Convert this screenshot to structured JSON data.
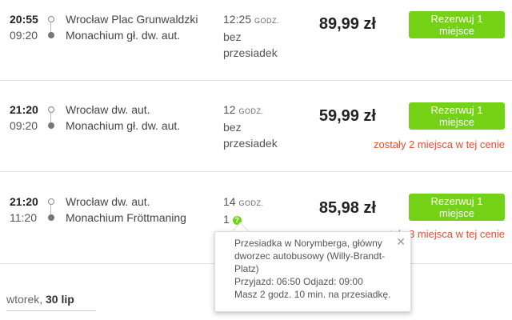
{
  "connections": [
    {
      "departure": "20:55",
      "arrival": "09:20",
      "from": "Wrocław Plac Grunwaldzki",
      "to": "Monachium gł. dw. aut.",
      "duration_num": "12:25",
      "duration_unit": "GODZ.",
      "transfer_line1": "bez",
      "transfer_line2": "przesiadek",
      "price": "89,99 zł",
      "button": "Rezerwuj 1 miejsce",
      "note": ""
    },
    {
      "departure": "21:20",
      "arrival": "09:20",
      "from": "Wrocław dw. aut.",
      "to": "Monachium gł. dw. aut.",
      "duration_num": "12",
      "duration_unit": "GODZ.",
      "transfer_line1": "bez",
      "transfer_line2": "przesiadek",
      "price": "59,99 zł",
      "button": "Rezerwuj 1 miejsce",
      "note": "zostały 2 miejsca w tej cenie"
    },
    {
      "departure": "21:20",
      "arrival": "11:20",
      "from": "Wrocław dw. aut.",
      "to": "Monachium Fröttmaning",
      "duration_num": "14",
      "duration_unit": "GODZ.",
      "transfers": "1",
      "price": "85,98 zł",
      "button": "Rezerwuj 1 miejsce",
      "note": "zostały 3 miejsca w tej cenie"
    }
  ],
  "tooltip": {
    "line1": "Przesiadka w Norymberga, główny",
    "line2": "dworzec autobusowy (Willy-Brandt-",
    "line3": "Platz)",
    "line4": "Przyjazd: 06:50 Odjazd: 09:00",
    "line5": "Masz 2 godz. 10 min. na przesiadkę.",
    "close": "✕"
  },
  "date": {
    "weekday": "wtorek,",
    "day": "30 lip"
  },
  "colors": {
    "accent": "#73d216",
    "warning": "#e0502a"
  }
}
